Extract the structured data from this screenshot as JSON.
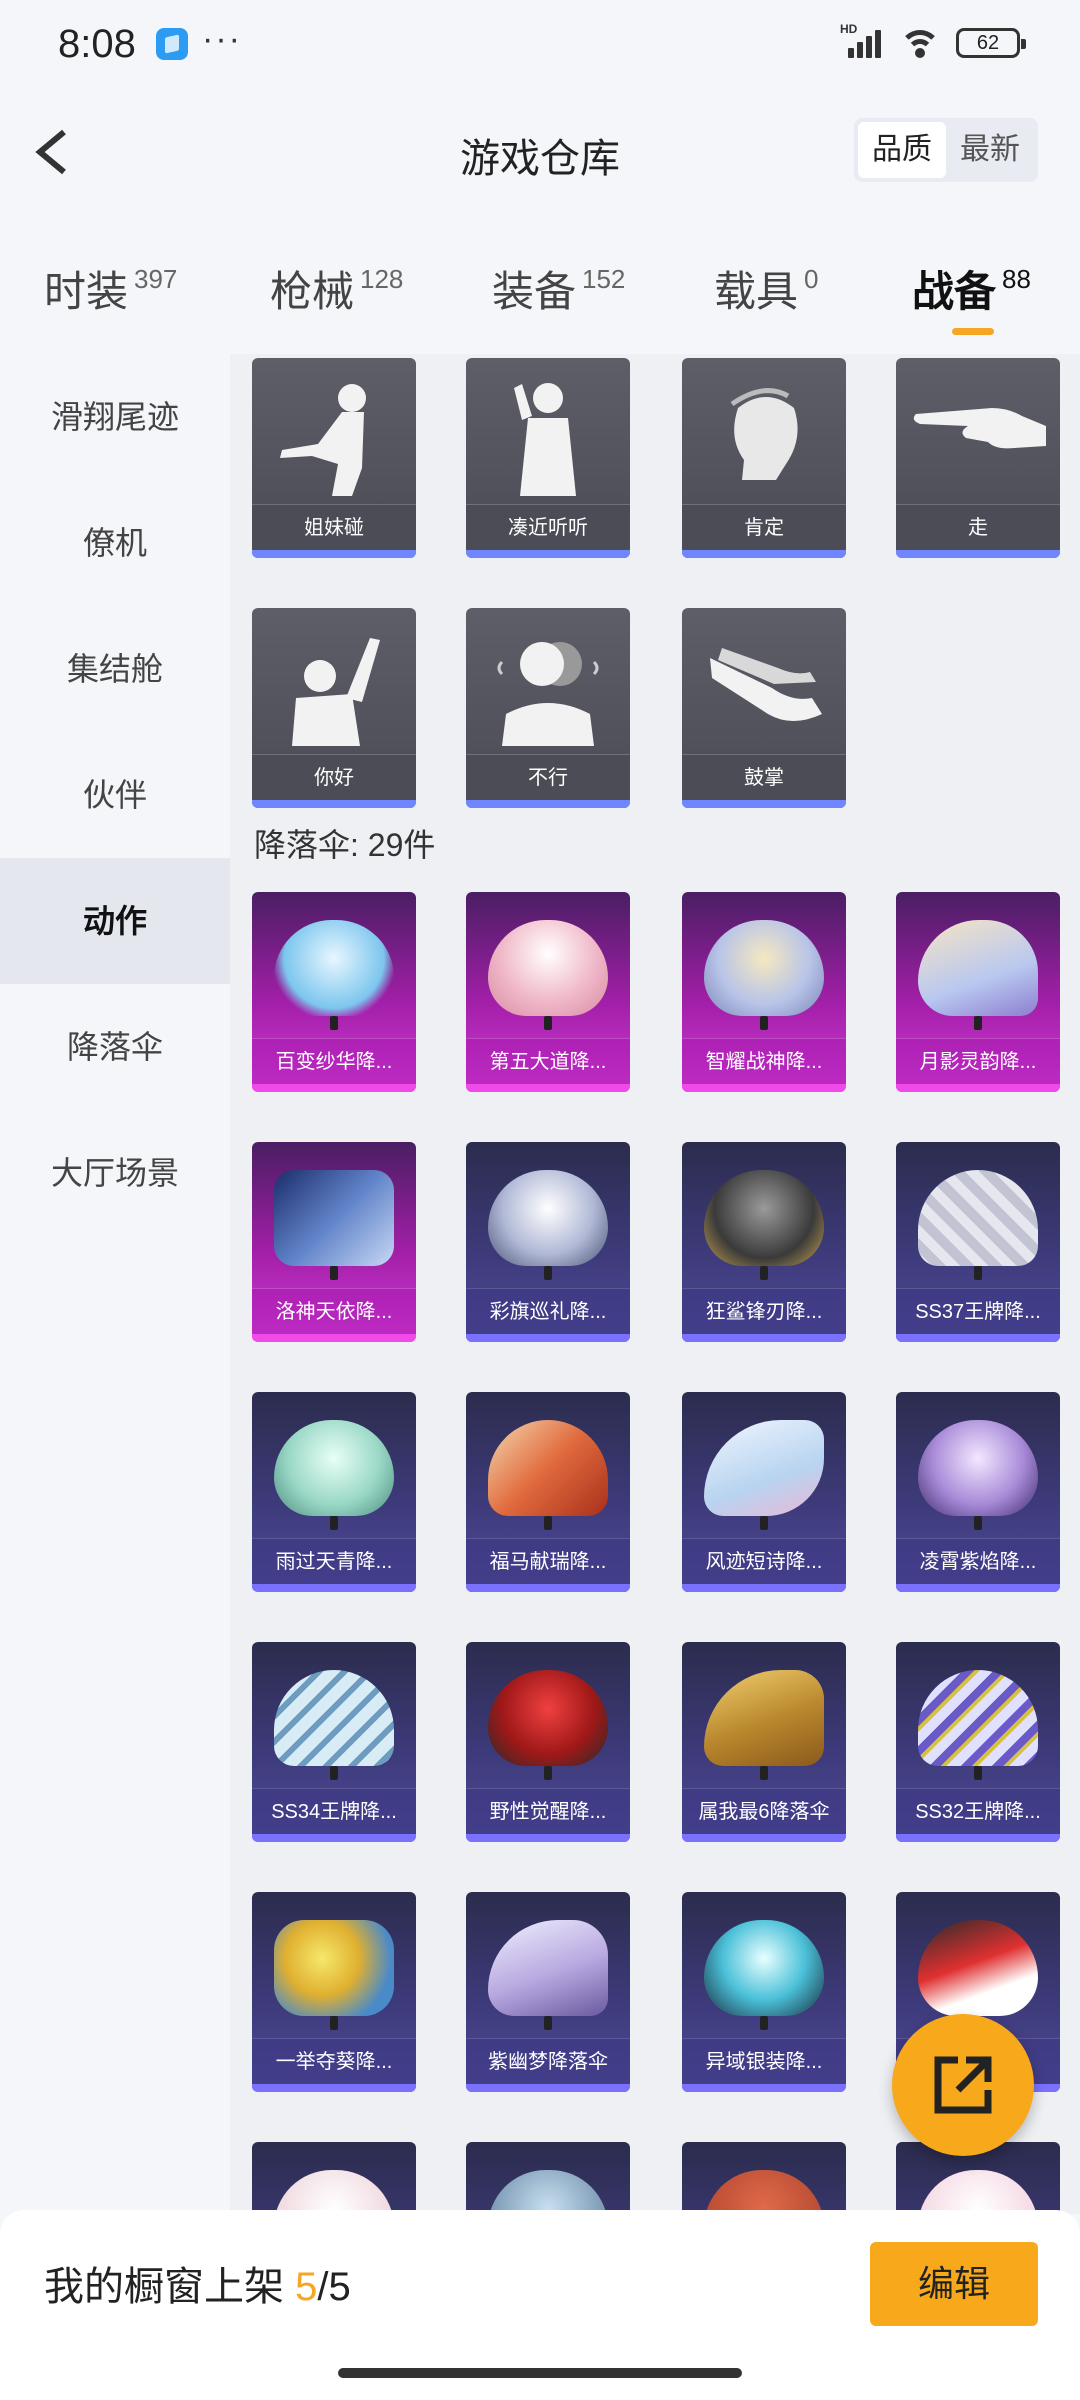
{
  "status_bar": {
    "time": "8:08",
    "more": "···",
    "signal_tag": "HD",
    "battery": "62"
  },
  "header": {
    "title": "游戏仓库",
    "sort": {
      "quality": "品质",
      "latest": "最新"
    }
  },
  "tabs": [
    {
      "label": "时装",
      "count": "397"
    },
    {
      "label": "枪械",
      "count": "128"
    },
    {
      "label": "装备",
      "count": "152"
    },
    {
      "label": "载具",
      "count": "0"
    },
    {
      "label": "战备",
      "count": "88",
      "active": true
    }
  ],
  "sidebar": {
    "items": [
      "滑翔尾迹",
      "僚机",
      "集结舱",
      "伙伴",
      "动作",
      "降落伞",
      "大厅场景"
    ],
    "active": "动作"
  },
  "actions": [
    "姐妹碰",
    "凑近听听",
    "肯定",
    "走",
    "你好",
    "不行",
    "鼓掌"
  ],
  "parachute_section": {
    "title": "降落伞: 29件"
  },
  "parachutes": [
    {
      "name": "百变纱华降...",
      "rarity": "pink"
    },
    {
      "name": "第五大道降...",
      "rarity": "pink"
    },
    {
      "name": "智耀战神降...",
      "rarity": "pink"
    },
    {
      "name": "月影灵韵降...",
      "rarity": "pink"
    },
    {
      "name": "洛神天依降...",
      "rarity": "pink"
    },
    {
      "name": "彩旗巡礼降...",
      "rarity": "purple"
    },
    {
      "name": "狂鲨锋刃降...",
      "rarity": "purple"
    },
    {
      "name": "SS37王牌降...",
      "rarity": "purple"
    },
    {
      "name": "雨过天青降...",
      "rarity": "purple"
    },
    {
      "name": "福马献瑞降...",
      "rarity": "purple"
    },
    {
      "name": "风迹短诗降...",
      "rarity": "purple"
    },
    {
      "name": "凌霄紫焰降...",
      "rarity": "purple"
    },
    {
      "name": "SS34王牌降...",
      "rarity": "purple"
    },
    {
      "name": "野性觉醒降...",
      "rarity": "purple"
    },
    {
      "name": "属我最6降落伞",
      "rarity": "purple"
    },
    {
      "name": "SS32王牌降...",
      "rarity": "purple"
    },
    {
      "name": "一举夺葵降...",
      "rarity": "purple"
    },
    {
      "name": "紫幽梦降落伞",
      "rarity": "purple"
    },
    {
      "name": "异域银装降...",
      "rarity": "purple"
    },
    {
      "name": "",
      "rarity": "purple"
    }
  ],
  "bottom_bar": {
    "showcase_prefix": "我的橱窗上架 ",
    "showcase_current": "5",
    "showcase_total": "/5",
    "edit_label": "编辑"
  },
  "colors": {
    "accent": "#f7a81b",
    "legendary": "#d43bd6",
    "epic": "#4f4b9a",
    "action_bar": "#6f86ff"
  }
}
